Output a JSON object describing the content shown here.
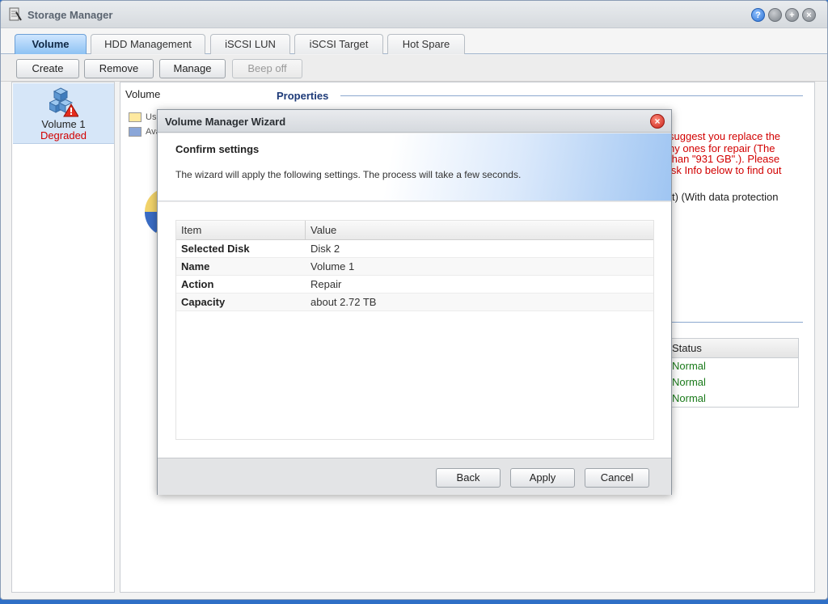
{
  "window": {
    "title": "Storage Manager",
    "controls": [
      "?",
      "",
      "+",
      "×"
    ]
  },
  "tabs": [
    {
      "label": "Volume",
      "active": true
    },
    {
      "label": "HDD Management",
      "active": false
    },
    {
      "label": "iSCSI LUN",
      "active": false
    },
    {
      "label": "iSCSI Target",
      "active": false
    },
    {
      "label": "Hot Spare",
      "active": false
    }
  ],
  "toolbar": {
    "create": "Create",
    "remove": "Remove",
    "manage": "Manage",
    "beep_off": "Beep off"
  },
  "sidebar": {
    "volume_name": "Volume 1",
    "volume_status": "Degraded",
    "icon": "volume-warning-icon"
  },
  "main": {
    "volume_label": "Volume",
    "legend": [
      "Us",
      "Ava"
    ],
    "properties_title": "Properties",
    "warning_lines": [
      "suggest you replace the",
      "hy ones for repair (The",
      "than \"931 GB\".). Please",
      "isk Info below to find out"
    ],
    "raid_line": "t) (With data protection",
    "status_header": "Status",
    "status_values": [
      "Normal",
      "Normal",
      "Normal"
    ]
  },
  "wizard": {
    "title": "Volume Manager Wizard",
    "heading": "Confirm settings",
    "description": "The wizard will apply the following settings. The process will take a few seconds.",
    "columns": [
      "Item",
      "Value"
    ],
    "rows": [
      {
        "item": "Selected Disk",
        "value": "Disk 2"
      },
      {
        "item": "Name",
        "value": "Volume 1"
      },
      {
        "item": "Action",
        "value": "Repair"
      },
      {
        "item": "Capacity",
        "value": "about 2.72 TB"
      }
    ],
    "buttons": {
      "back": "Back",
      "apply": "Apply",
      "cancel": "Cancel"
    }
  },
  "colors": {
    "accent": "#8dc2f3",
    "warning": "#d20000",
    "status_ok": "#1a7a1a"
  }
}
